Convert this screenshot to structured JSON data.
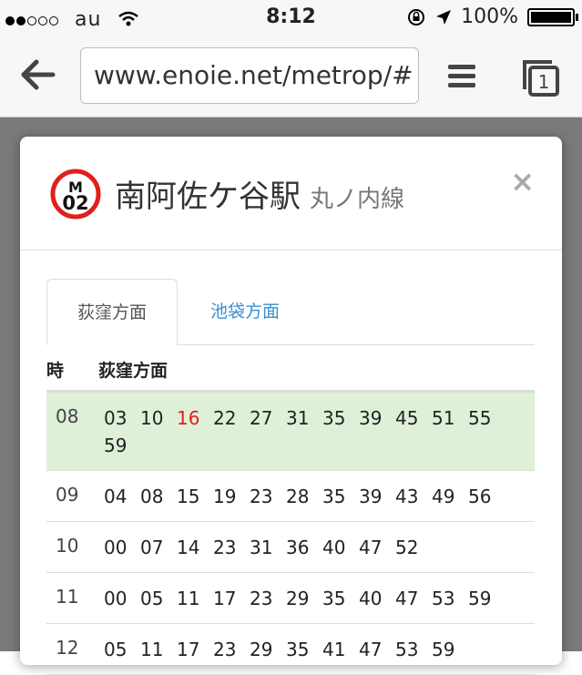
{
  "status_bar": {
    "carrier": "au",
    "time": "8:12",
    "battery": "100%",
    "signal_dots_filled": 2,
    "signal_dots_total": 5
  },
  "browser": {
    "url": "www.enoie.net/metrop/#",
    "tab_count": "1"
  },
  "modal": {
    "badge_line": "M",
    "badge_number": "02",
    "station": "南阿佐ケ谷駅",
    "line_name": "丸ノ内線",
    "close": "×",
    "tabs": [
      {
        "label": "荻窪方面",
        "active": true
      },
      {
        "label": "池袋方面",
        "active": false
      }
    ],
    "table_header": {
      "hour": "時",
      "direction": "荻窪方面"
    },
    "rows": [
      {
        "hour": "08",
        "minutes": [
          "03",
          "10",
          "16",
          "22",
          "27",
          "31",
          "35",
          "39",
          "45",
          "51",
          "55",
          "59"
        ],
        "highlight_minute": "16"
      },
      {
        "hour": "09",
        "minutes": [
          "04",
          "08",
          "15",
          "19",
          "23",
          "28",
          "35",
          "39",
          "43",
          "49",
          "56"
        ]
      },
      {
        "hour": "10",
        "minutes": [
          "00",
          "07",
          "14",
          "23",
          "31",
          "36",
          "40",
          "47",
          "52"
        ]
      },
      {
        "hour": "11",
        "minutes": [
          "00",
          "05",
          "11",
          "17",
          "23",
          "29",
          "35",
          "40",
          "47",
          "53",
          "59"
        ]
      },
      {
        "hour": "12",
        "minutes": [
          "05",
          "11",
          "17",
          "23",
          "29",
          "35",
          "41",
          "47",
          "53",
          "59"
        ]
      }
    ]
  },
  "colors": {
    "badge_ring": "#e0201c",
    "highlight_row": "#dff0d8",
    "tab_link": "#3b8fd0",
    "red_minute": "#e0201c"
  }
}
